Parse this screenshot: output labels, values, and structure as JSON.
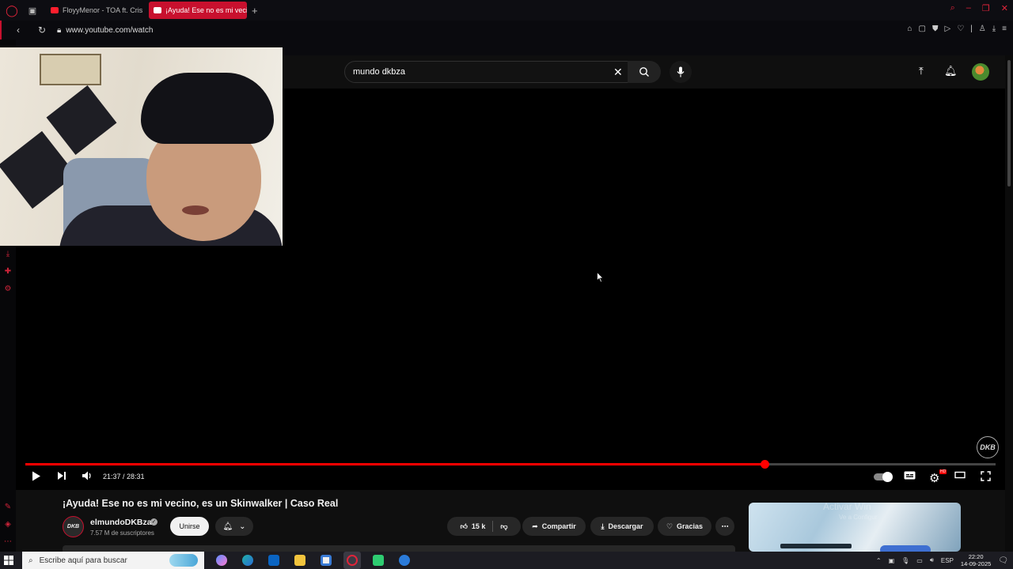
{
  "browser": {
    "tabs": [
      {
        "title": "FloyyMenor - TOA ft. Cris"
      },
      {
        "title": "¡Ayuda! Ese no es mi veci"
      }
    ],
    "new_tab": "+",
    "url": "www.youtube.com/watch"
  },
  "youtube": {
    "search": {
      "value": "mundo dkbza"
    },
    "player": {
      "time": "21:37 / 28:31",
      "progress_fraction": 0.762,
      "watermark": "DKB"
    },
    "video": {
      "title": "¡Ayuda! Ese no es mi vecino, es un Skinwalker | Caso Real",
      "channel": "elmundoDKBza",
      "subscribers": "7.57 M de suscriptores",
      "channel_avatar_text": "DKB",
      "join_label": "Unirse",
      "likes": "15 k",
      "share_label": "Compartir",
      "download_label": "Descargar",
      "thanks_label": "Gracias"
    },
    "ad_overlay": {
      "line1": "Activar Win",
      "line2": "Ve a Configur"
    }
  },
  "taskbar": {
    "search_placeholder": "Escribe aquí para buscar",
    "language": "ESP",
    "time": "22:20",
    "date": "14-09-2025"
  },
  "colors": {
    "accent": "#c8102e",
    "progress": "#ff0000",
    "background": "#0f0f0f"
  }
}
